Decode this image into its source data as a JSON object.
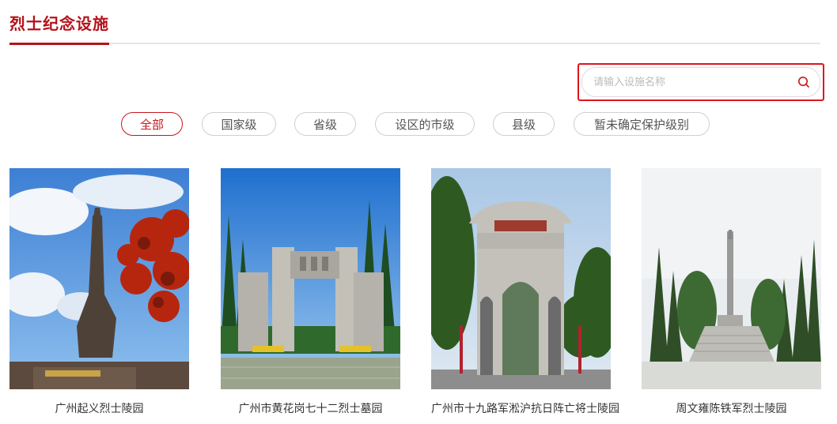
{
  "section": {
    "title": "烈士纪念设施"
  },
  "search": {
    "placeholder": "请输入设施名称",
    "value": "",
    "icon": "search-icon"
  },
  "filters": [
    {
      "label": "全部",
      "active": true
    },
    {
      "label": "国家级",
      "active": false
    },
    {
      "label": "省级",
      "active": false
    },
    {
      "label": "设区的市级",
      "active": false
    },
    {
      "label": "县级",
      "active": false
    },
    {
      "label": "暂未确定保护级别",
      "active": false
    }
  ],
  "cards": [
    {
      "name": "广州起义烈士陵园"
    },
    {
      "name": "广州市黄花岗七十二烈士墓园"
    },
    {
      "name": "广州市十九路军淞沪抗日阵亡将士陵园"
    },
    {
      "name": "周文雍陈铁军烈士陵园"
    }
  ],
  "colors": {
    "accent": "#b5121b",
    "highlight": "#e0141e"
  }
}
